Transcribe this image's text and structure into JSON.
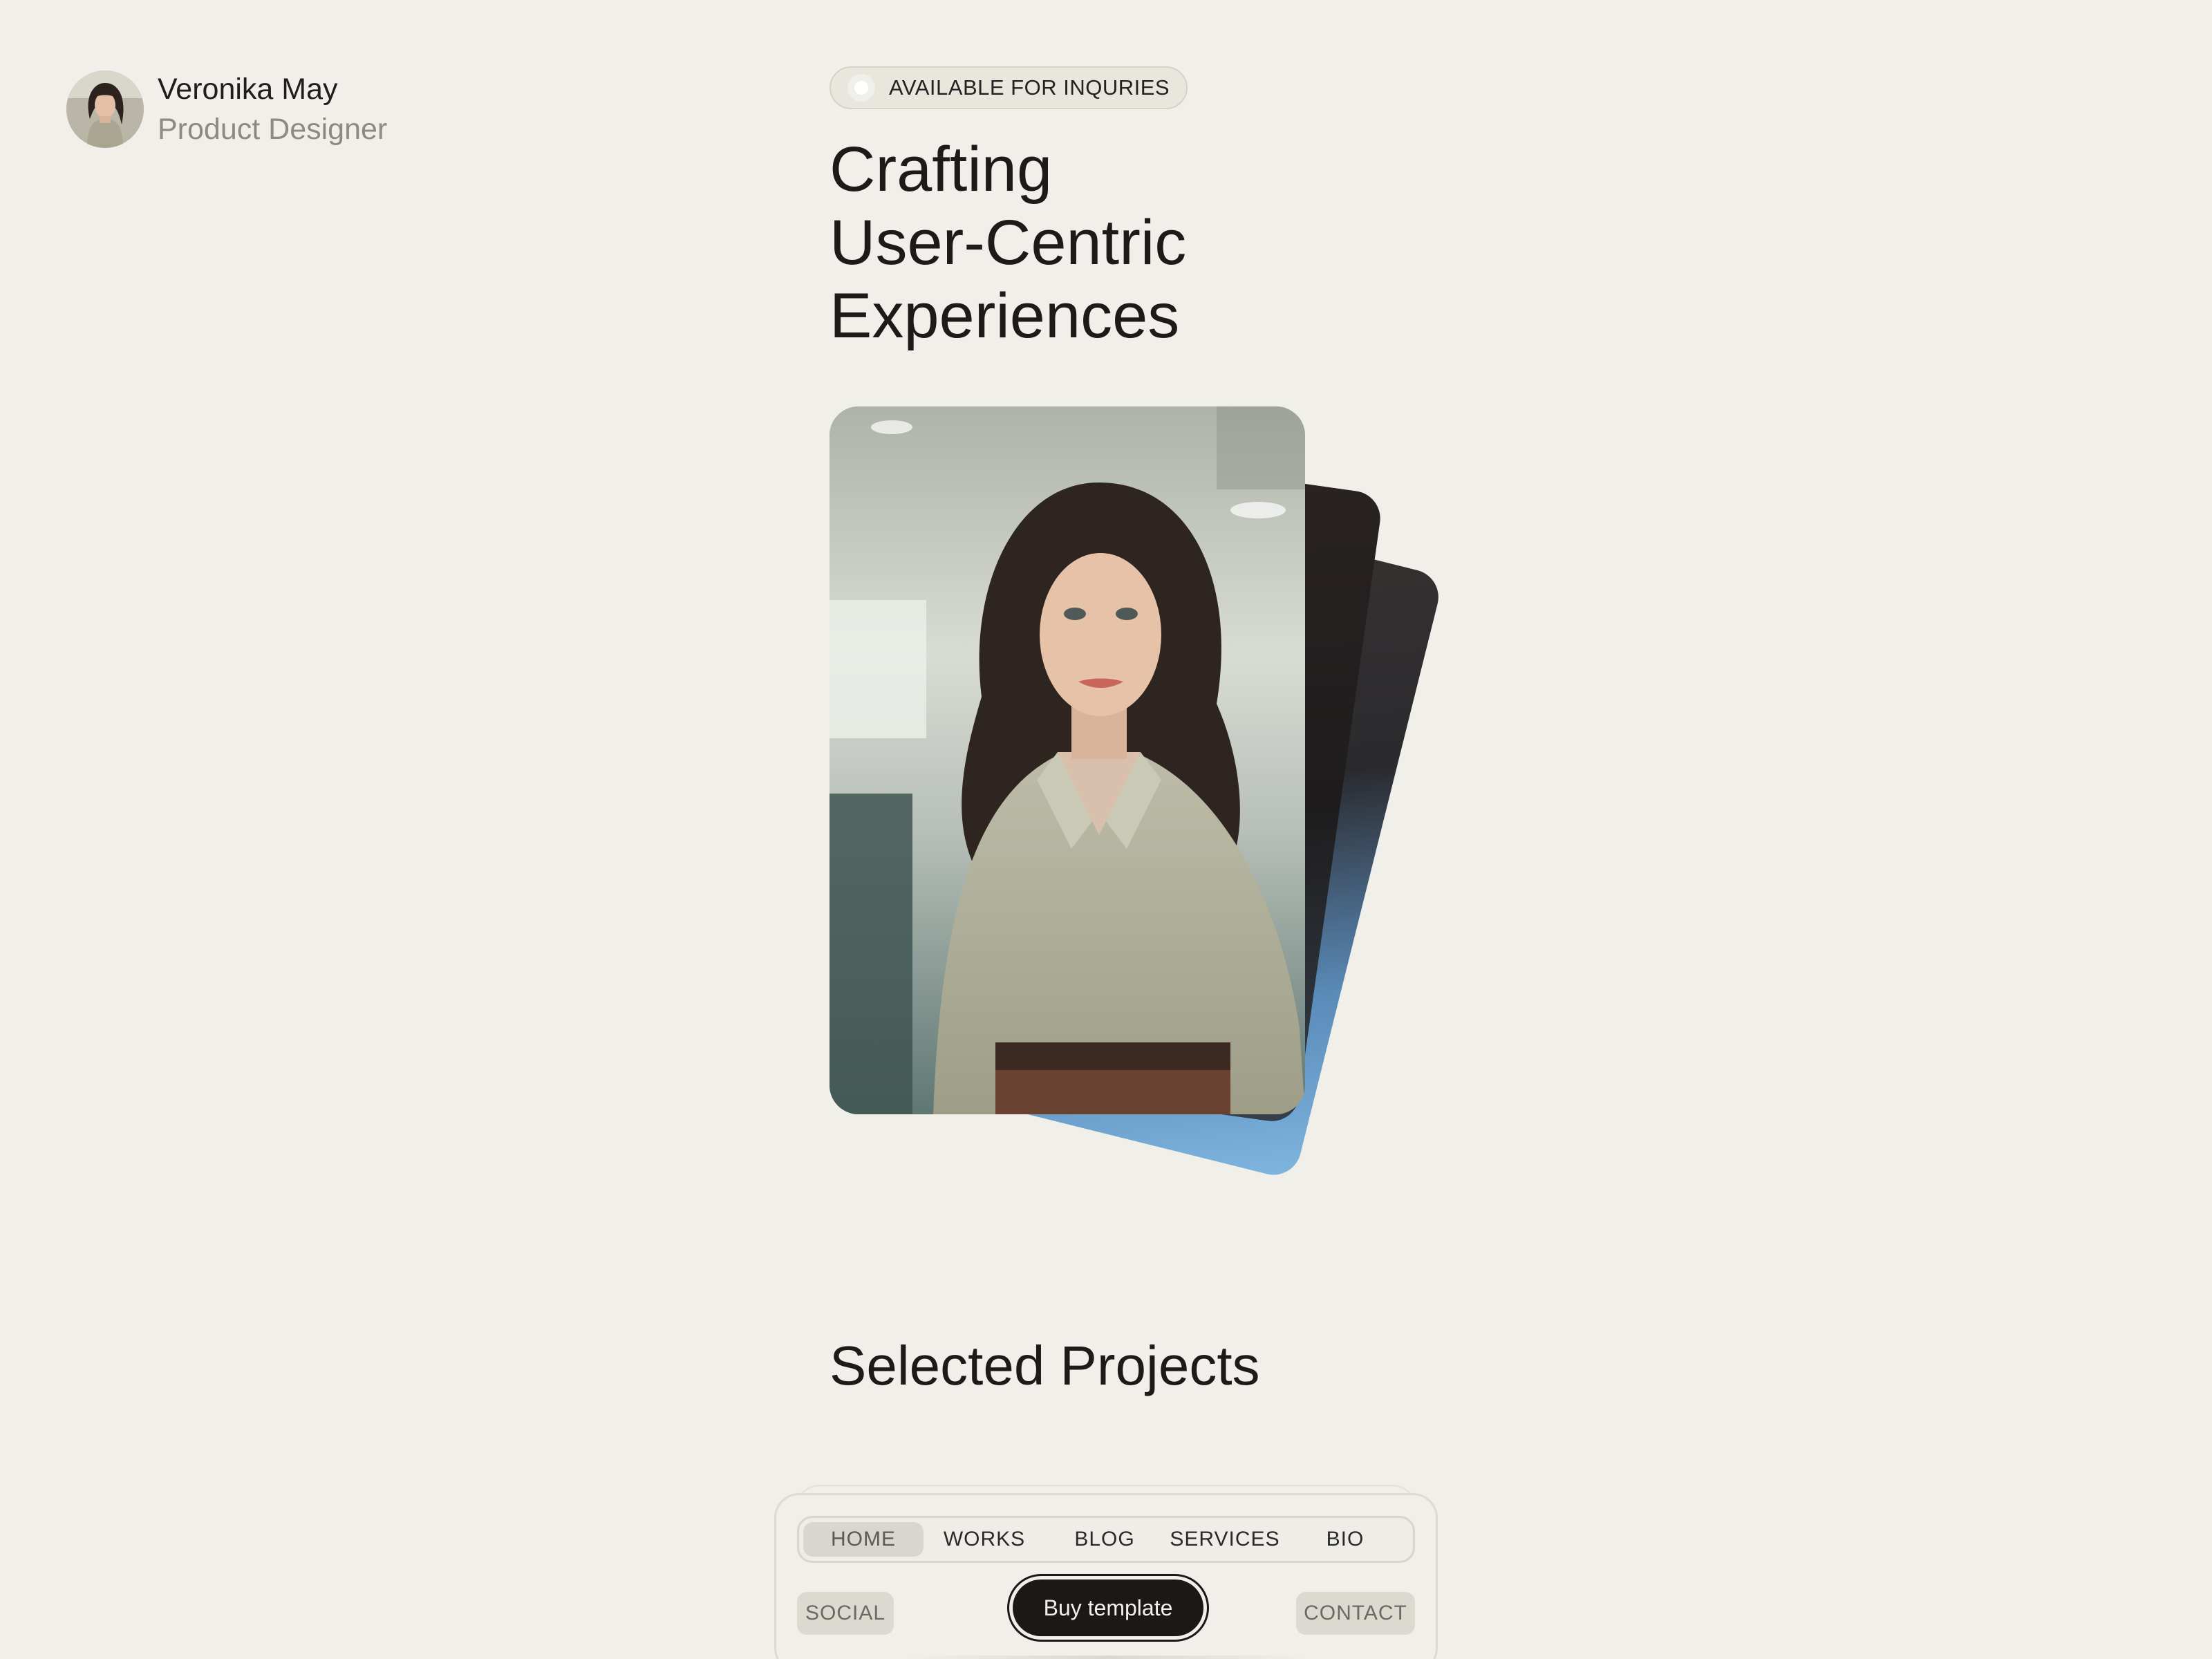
{
  "profile": {
    "name": "Veronika May",
    "role": "Product Designer"
  },
  "badge": {
    "text": "AVAILABLE FOR INQURIES"
  },
  "hero": {
    "title_lines": [
      "Crafting",
      "User-Centric",
      "Experiences"
    ]
  },
  "projects": {
    "title": "Selected Projects"
  },
  "nav": {
    "tabs": [
      {
        "label": "HOME",
        "active": true
      },
      {
        "label": "WORKS",
        "active": false
      },
      {
        "label": "BLOG",
        "active": false
      },
      {
        "label": "SERVICES",
        "active": false
      },
      {
        "label": "BIO",
        "active": false
      }
    ],
    "social_label": "SOCIAL",
    "buy_label": "Buy template",
    "contact_label": "CONTACT"
  },
  "colors": {
    "background": "#f1efe9",
    "text": "#1c1b19",
    "muted": "#8d8a84",
    "button_dark": "#1a1918"
  }
}
